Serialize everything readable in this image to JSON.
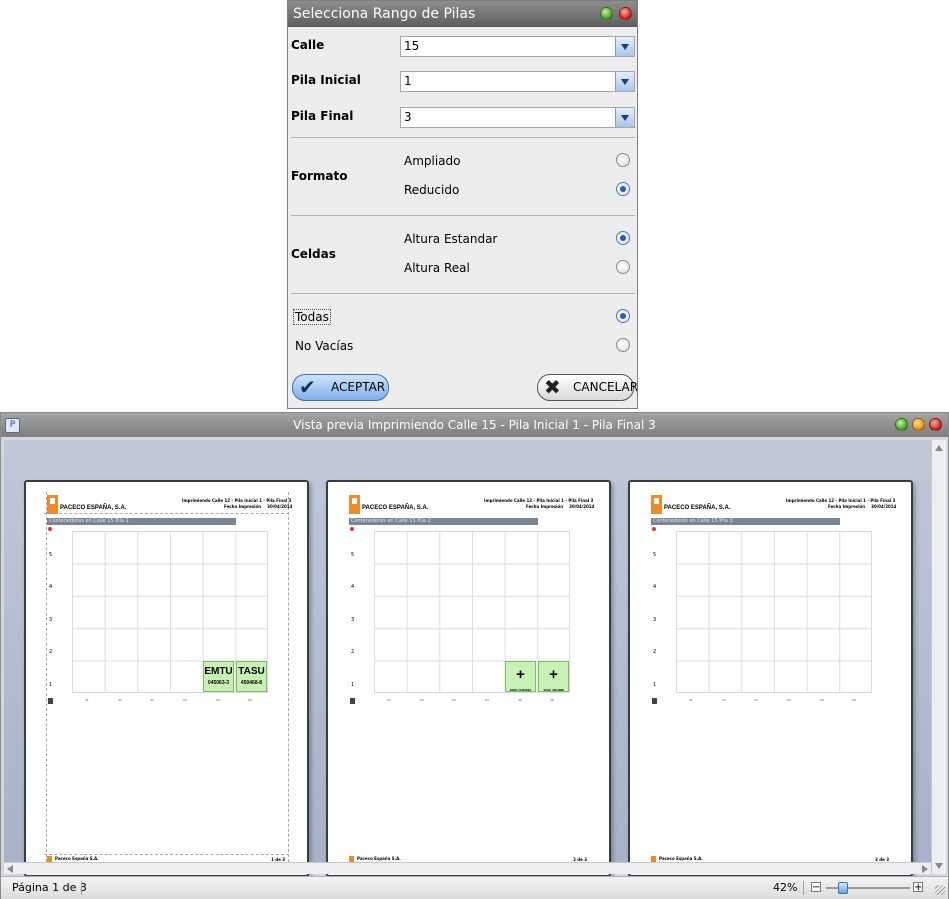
{
  "dialog": {
    "title": "Selecciona Rango de Pilas",
    "calle": {
      "label": "Calle",
      "value": "15"
    },
    "pila_inicial": {
      "label": "Pila Inicial",
      "value": "1"
    },
    "pila_final": {
      "label": "Pila Final",
      "value": "3"
    },
    "formato": {
      "label": "Formato",
      "options": [
        {
          "label": "Ampliado",
          "selected": false
        },
        {
          "label": "Reducido",
          "selected": true
        }
      ]
    },
    "celdas": {
      "label": "Celdas",
      "options": [
        {
          "label": "Altura Estandar",
          "selected": true
        },
        {
          "label": "Altura Real",
          "selected": false
        }
      ]
    },
    "filtro": {
      "options": [
        {
          "label": "Todas",
          "selected": true
        },
        {
          "label": "No Vacías",
          "selected": false
        }
      ]
    },
    "accept_label": "ACEPTAR",
    "cancel_label": "CANCELAR",
    "accept_icon": "check-icon",
    "cancel_icon": "x-icon"
  },
  "preview": {
    "title": "Vista previa Imprimiendo Calle 15 - Pila Inicial 1 - Pila Final 3",
    "status_page": "Página 1 de 3",
    "zoom": "42%",
    "zoom_level": 0.2,
    "pages": [
      {
        "company": "PACECO ESPAÑA, S.A.",
        "header_line1": "Imprimiendo Calle 12 - Pila Inicial 1 - Pila Final 3",
        "header_date_label": "Fecha Impresión",
        "header_date": "30/04/2014",
        "bar_text": "Contenedores en Calle 15 Pila 1",
        "footer": "Paceco España S.A.",
        "page_num": "1 de 3",
        "cells": [
          {
            "code": "EMTU",
            "number": "045063-3"
          },
          {
            "code": "TASU",
            "number": "450468-8"
          }
        ]
      },
      {
        "company": "PACECO ESPAÑA, S.A.",
        "header_line1": "Imprimiendo Calle 12 - Pila Inicial 1 - Pila Final 3",
        "header_date_label": "Fecha Impresión",
        "header_date": "30/04/2014",
        "bar_text": "Contenedores en Calle 15 Pila 2",
        "footer": "Paceco España S.A.",
        "page_num": "2 de 3",
        "cells": [
          {
            "code": "EMTU 0450633",
            "symbol": "+"
          },
          {
            "code": "TASU 4504688",
            "symbol": "+"
          }
        ]
      },
      {
        "company": "PACECO ESPAÑA, S.A.",
        "header_line1": "Imprimiendo Calle 12 - Pila Inicial 1 - Pila Final 3",
        "header_date_label": "Fecha Impresión",
        "header_date": "30/04/2014",
        "bar_text": "Contenedores en Calle 15 Pila 3",
        "footer": "Paceco España S.A.",
        "page_num": "3 de 3",
        "cells": []
      }
    ],
    "y_labels": [
      "5",
      "4",
      "3",
      "2",
      "1"
    ],
    "x_labels": [
      "01",
      "02",
      "03",
      "04",
      "05",
      "06"
    ]
  }
}
